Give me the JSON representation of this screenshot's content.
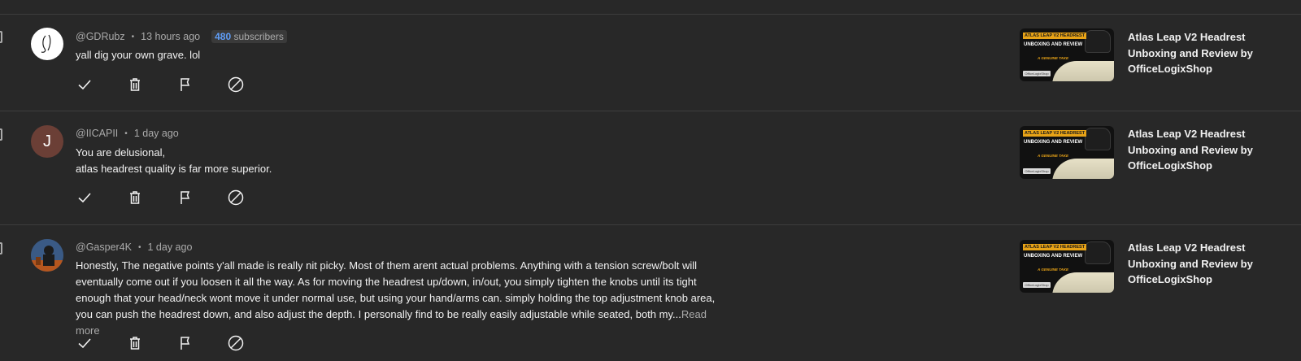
{
  "comments": [
    {
      "author": "@GDRubz",
      "time": "13 hours ago",
      "subscribers_count": "480",
      "subscribers_label": " subscribers",
      "text_lines": [
        "yall dig your own grave. lol"
      ],
      "read_more": "",
      "avatar": {
        "type": "logo",
        "letter": ""
      },
      "video": {
        "title_lines": [
          "Atlas Leap V2 Headrest",
          "Unboxing and Review by",
          "OfficeLogixShop"
        ]
      }
    },
    {
      "author": "@IICAPII",
      "time": "1 day ago",
      "text_lines": [
        "You are delusional,",
        "atlas headrest quality is far more superior."
      ],
      "read_more": "",
      "avatar": {
        "type": "letter",
        "letter": "J",
        "color": "#6b3f36"
      },
      "video": {
        "title_lines": [
          "Atlas Leap V2 Headrest",
          "Unboxing and Review by",
          "OfficeLogixShop"
        ]
      }
    },
    {
      "author": "@Gasper4K",
      "time": "1 day ago",
      "text_lines": [
        "Honestly, The negative points y'all made is really nit picky. Most of them arent actual problems. Anything with a tension screw/bolt will",
        "eventually come out if you loosen it all the way. As for moving the headrest up/down, in/out, you simply tighten the knobs until its tight",
        "enough that your head/neck wont move it under normal use, but using your hand/arms can. simply holding the top adjustment knob area,",
        "you can push the headrest down, and also adjust the depth. I personally find to be really easily adjustable while seated, both my..."
      ],
      "read_more": "Read more",
      "avatar": {
        "type": "photo",
        "letter": ""
      },
      "video": {
        "title_lines": [
          "Atlas Leap V2 Headrest",
          "Unboxing and Review by",
          "OfficeLogixShop"
        ]
      }
    }
  ],
  "thumbnail": {
    "tag": "ATLAS LEAP V2 HEADREST",
    "headline_1": "UNBOXING AND REVIEW",
    "subline": "A GENUINE TAKE",
    "badge": "OfficeLogixShop"
  },
  "icons": [
    "check-icon",
    "trash-icon",
    "flag-icon",
    "block-icon"
  ],
  "colors": {
    "background": "#282828",
    "text": "#f1f1f1",
    "muted": "#aaaaaa",
    "subscriber_count": "#5f9df7",
    "accent": "#e8a317"
  }
}
